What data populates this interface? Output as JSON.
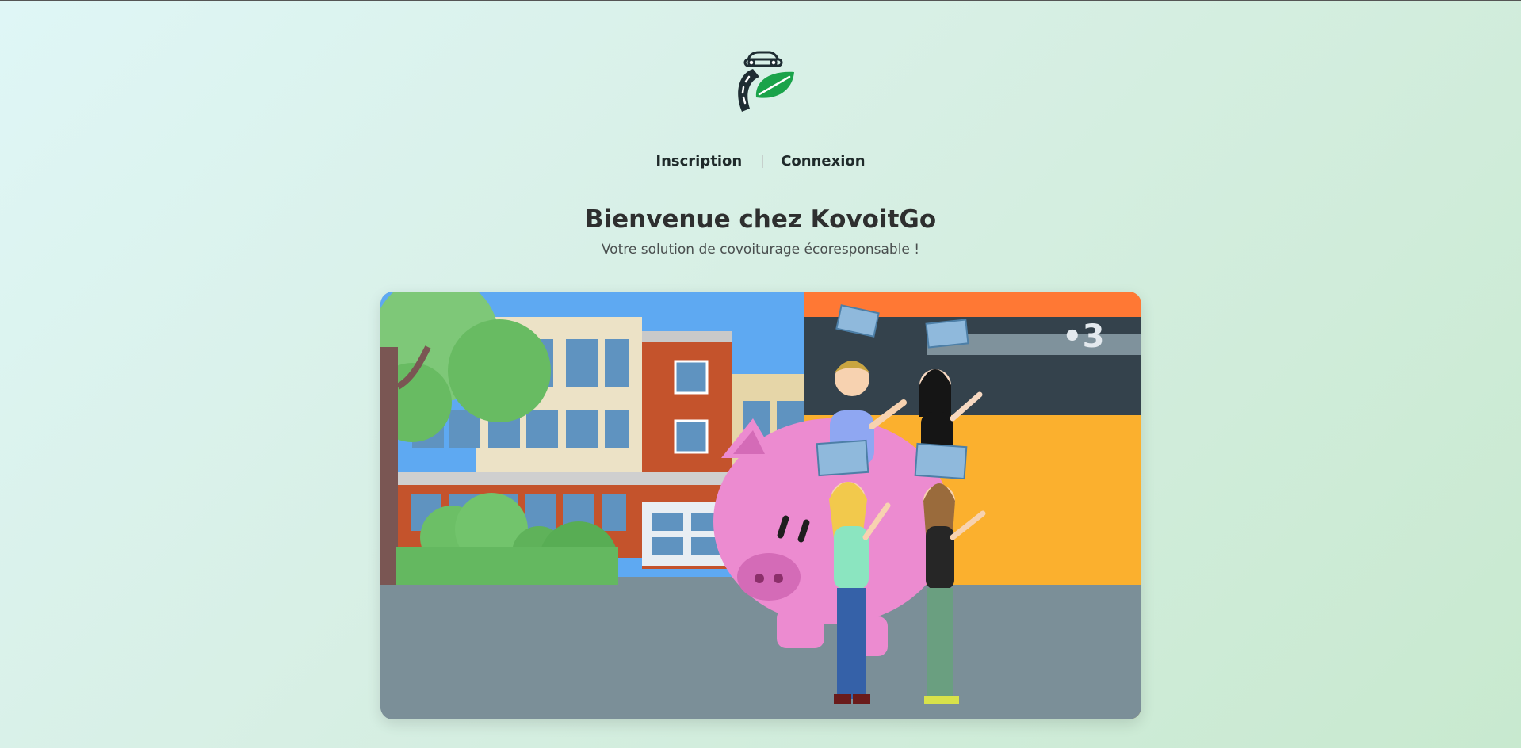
{
  "brand": {
    "logo_icon": "car-leaf-road-logo-icon"
  },
  "nav": {
    "signup_label": "Inscription",
    "login_label": "Connexion"
  },
  "hero": {
    "title": "Bienvenue chez KovoitGo",
    "subtitle": "Votre solution de covoiturage écoresponsable !",
    "illustration": "piggy-bank-people-illustration",
    "channel_logo": "•3"
  },
  "colors": {
    "brand_green": "#1aa34a",
    "logo_dark": "#1f2d33",
    "heading": "#2e2f2f"
  }
}
